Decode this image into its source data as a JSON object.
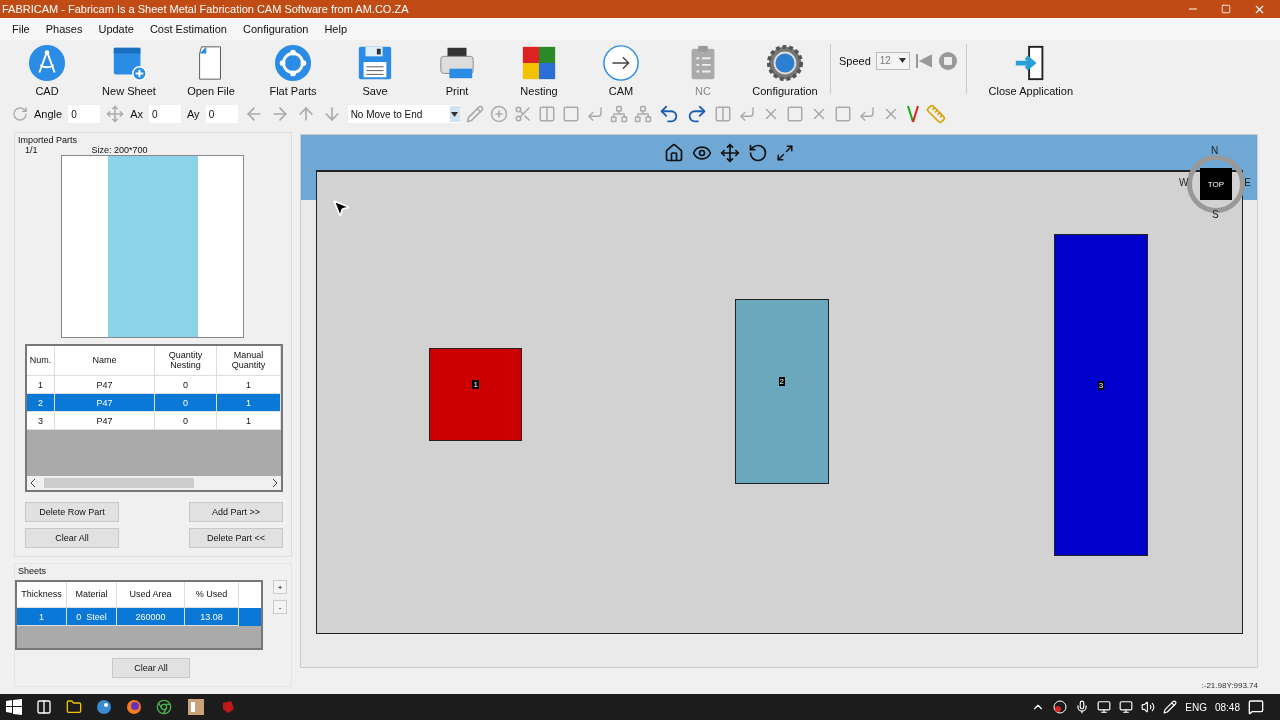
{
  "window": {
    "title": "FABRICAM - Fabricam Is a Sheet Metal Fabrication CAM Software from AM.CO.ZA"
  },
  "menu": [
    "File",
    "Phases",
    "Update",
    "Cost Estimation",
    "Configuration",
    "Help"
  ],
  "main_toolbar": [
    {
      "label": "CAD",
      "kind": "cad",
      "disabled": false
    },
    {
      "label": "New Sheet",
      "kind": "sheet",
      "disabled": false
    },
    {
      "label": "Open File",
      "kind": "file",
      "disabled": false
    },
    {
      "label": "Flat Parts",
      "kind": "ring",
      "disabled": false
    },
    {
      "label": "Save",
      "kind": "save",
      "disabled": false
    },
    {
      "label": "Print",
      "kind": "print",
      "disabled": false
    },
    {
      "label": "Nesting",
      "kind": "puzzle",
      "disabled": false
    },
    {
      "label": "CAM",
      "kind": "arrow",
      "disabled": false
    },
    {
      "label": "NC",
      "kind": "clipboard",
      "disabled": true
    },
    {
      "label": "Configuration",
      "kind": "gear",
      "disabled": false
    }
  ],
  "speed": {
    "label": "Speed",
    "value": "12"
  },
  "close_button": {
    "label": "Close Application"
  },
  "transform_bar": {
    "angle_label": "Angle",
    "angle": "0",
    "ax_label": "Ax",
    "ax": "0",
    "ay_label": "Ay",
    "ay": "0",
    "move_mode": "No Move to End"
  },
  "imported_parts": {
    "title": "Imported Parts",
    "page": "1/1",
    "size": "Size: 200*700",
    "columns": [
      "Num.",
      "Name",
      "Quantity Nesting",
      "Manual Quantity"
    ],
    "rows": [
      {
        "num": "1",
        "name": "P47",
        "quantity_nesting": "0",
        "manual_quantity": "1",
        "selected": false
      },
      {
        "num": "2",
        "name": "P47",
        "quantity_nesting": "0",
        "manual_quantity": "1",
        "selected": true
      },
      {
        "num": "3",
        "name": "P47",
        "quantity_nesting": "0",
        "manual_quantity": "1",
        "selected": false
      }
    ],
    "buttons": [
      "Delete Row Part",
      "Add Part >>",
      "Clear All",
      "Delete Part <<"
    ]
  },
  "sheets": {
    "title": "Sheets",
    "columns": [
      "Thickness",
      "Material",
      "Used Area",
      "% Used"
    ],
    "rows": [
      {
        "thickness": "1",
        "material": "0  Steel",
        "used_area": "260000",
        "used": "13.08",
        "selected": true
      }
    ],
    "side_buttons": [
      "+",
      "-"
    ],
    "clear_button": "Clear All"
  },
  "viewport": {
    "compass": {
      "n": "N",
      "w": "W",
      "e": "E",
      "s": "S",
      "face": "TOP"
    },
    "parts": [
      {
        "label": "1",
        "color": "#cc0000"
      },
      {
        "label": "2",
        "color": "#6aa8bd"
      },
      {
        "label": "3",
        "color": "#0000cc"
      }
    ]
  },
  "status": {
    "coordinates": ":-21.98Y:993.74"
  },
  "taskbar": {
    "language": "ENG",
    "time": "08:48"
  }
}
